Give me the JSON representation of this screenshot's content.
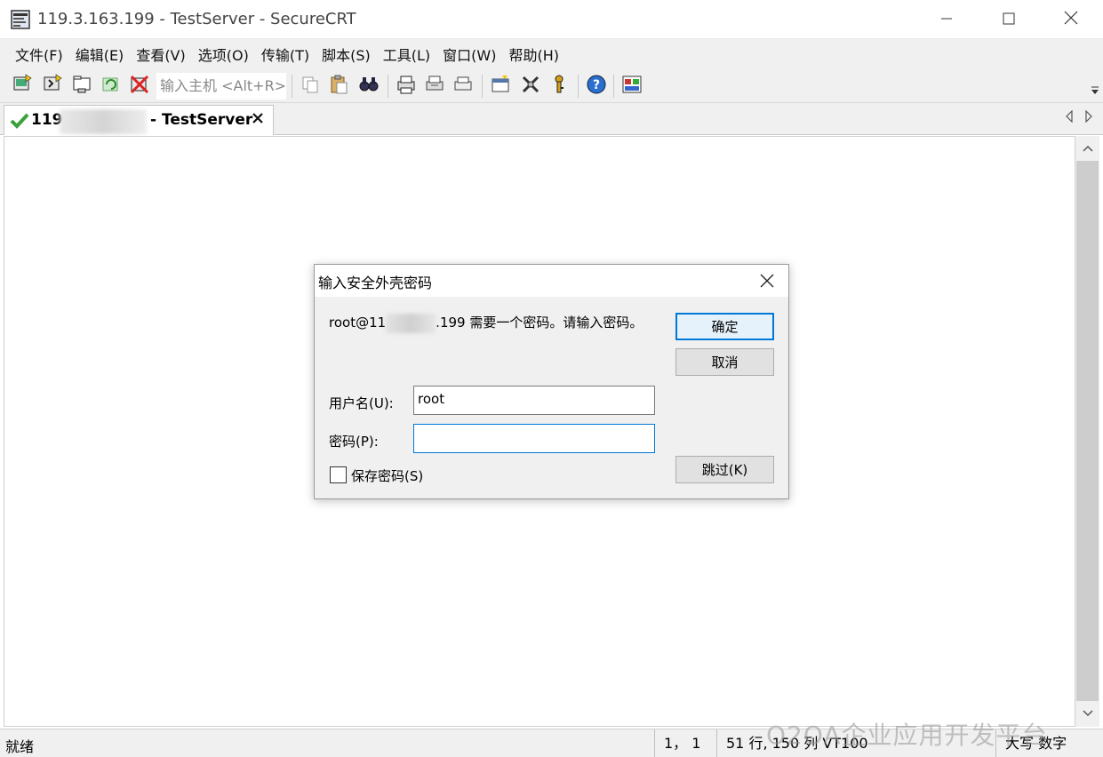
{
  "window": {
    "title": "119.3.163.199 - TestServer - SecureCRT",
    "minimize_icon": "minimize-icon",
    "maximize_icon": "maximize-icon",
    "close_icon": "close-icon"
  },
  "menu": [
    "文件(F)",
    "编辑(E)",
    "查看(V)",
    "选项(O)",
    "传输(T)",
    "脚本(S)",
    "工具(L)",
    "窗口(W)",
    "帮助(H)"
  ],
  "toolbar": {
    "host_input_placeholder": "输入主机 <Alt+R>",
    "icons": [
      "connect-icon",
      "quick-connect-icon",
      "connect-in-tab-icon",
      "reconnect-icon",
      "disconnect-icon",
      "copy-icon",
      "paste-icon",
      "find-icon",
      "print-icon",
      "print-setup-icon",
      "print-selection-icon",
      "session-options-icon",
      "global-options-icon",
      "key-icon",
      "help-icon",
      "sftp-icon"
    ]
  },
  "tab": {
    "prefix": "119",
    "suffix": "- TestServer",
    "status_icon": "connected-check-icon"
  },
  "dialog": {
    "title": "输入安全外壳密码",
    "message_prefix": "root@11",
    "message_suffix": ".199 需要一个密码。请输入密码。",
    "ok_label": "确定",
    "cancel_label": "取消",
    "skip_label": "跳过(K)",
    "username_label": "用户名(U):",
    "username_value": "root",
    "password_label": "密码(P):",
    "password_value": "",
    "save_password_label": "保存密码(S)",
    "save_password_checked": false
  },
  "status": {
    "ready": "就绪",
    "cursor": "1，  1",
    "size": "51 行, 150 列 VT100",
    "mode": "大写  数字"
  },
  "watermark": "O2OA企业应用开发平台"
}
